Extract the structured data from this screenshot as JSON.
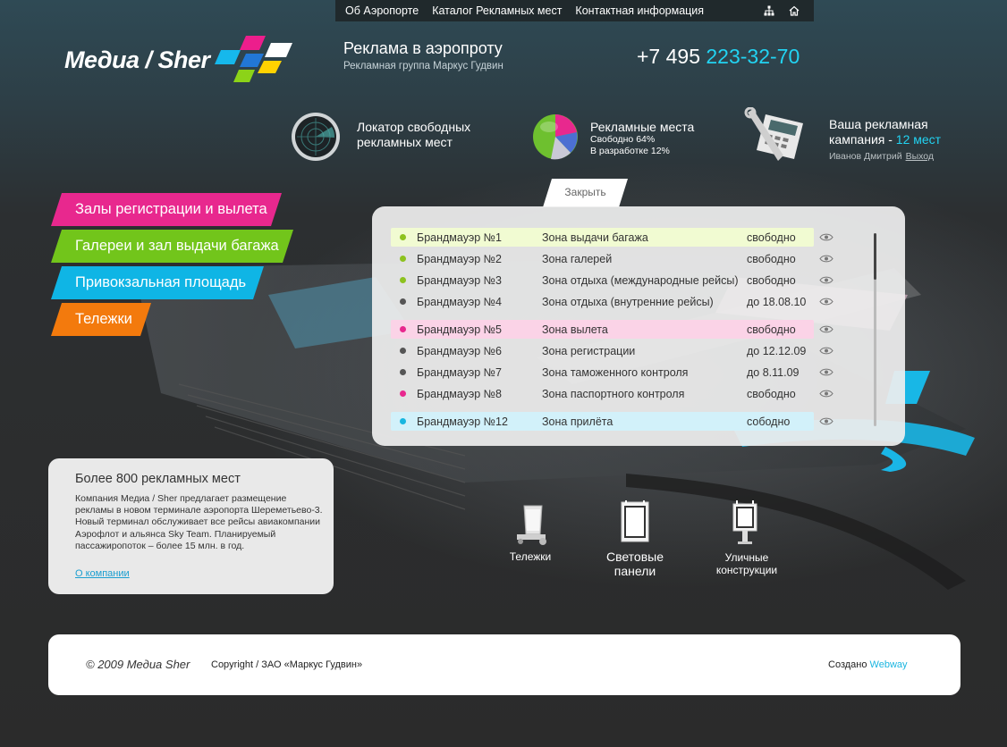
{
  "nav": {
    "links": [
      "Об Аэропорте",
      "Каталог Рекламных мест",
      "Контактная информация"
    ],
    "icons": [
      "sitemap-icon",
      "home-icon"
    ]
  },
  "logo": {
    "text": "Медиа / Sher"
  },
  "header": {
    "title": "Реклама в аэропроту",
    "subtitle": "Рекламная группа Маркус Гудвин",
    "phone_prefix": "+7 495 ",
    "phone_number": "223-32-70"
  },
  "info": {
    "locator": {
      "title_line1": "Локатор свободных",
      "title_line2": "рекламных мест",
      "icon": "radar-icon"
    },
    "places": {
      "title": "Рекламные места",
      "free": "Свободно 64%",
      "dev": "В разработке 12%",
      "icon": "pie-chart-icon"
    },
    "campaign": {
      "title_line1": "Ваша рекламная",
      "title_line2": "кампания - ",
      "count": "12 мест",
      "user": "Иванов Дмитрий",
      "logout": "Выход",
      "icon": "calculator-tools-icon"
    }
  },
  "categories": [
    {
      "label": "Залы регистрации и вылета",
      "color": "#e8288e"
    },
    {
      "label": "Галереи и зал выдачи багажа",
      "color": "#72c51b"
    },
    {
      "label": "Привокзальная площадь",
      "color": "#0fb5e5"
    },
    {
      "label": "Тележки",
      "color": "#f37a0d"
    }
  ],
  "close_label": "Закрыть",
  "list": [
    {
      "name": "Брандмауэр №1",
      "zone": "Зона выдачи багажа",
      "status": "свободно",
      "dot": "#8dc21f",
      "highlight": "#f1fbd2"
    },
    {
      "name": "Брандмауэр №2",
      "zone": "Зона галерей",
      "status": "свободно",
      "dot": "#8dc21f",
      "highlight": ""
    },
    {
      "name": "Брандмауэр №3",
      "zone": "Зона отдыха (международные рейсы)",
      "status": "свободно",
      "dot": "#8dc21f",
      "highlight": ""
    },
    {
      "name": "Брандмауэр №4",
      "zone": "Зона отдыха (внутренние рейсы)",
      "status": "до 18.08.10",
      "dot": "#555555",
      "highlight": ""
    },
    {
      "name": "Брандмауэр №5",
      "zone": "Зона вылета",
      "status": "свободно",
      "dot": "#e8288e",
      "highlight": "#fbd3e7"
    },
    {
      "name": "Брандмауэр №6",
      "zone": "Зона регистрации",
      "status": "до 12.12.09",
      "dot": "#555555",
      "highlight": ""
    },
    {
      "name": "Брандмауэр №7",
      "zone": "Зона таможенного контроля",
      "status": "до 8.11.09",
      "dot": "#555555",
      "highlight": ""
    },
    {
      "name": "Брандмауэр №8",
      "zone": "Зона паспортного контроля",
      "status": "свободно",
      "dot": "#e8288e",
      "highlight": ""
    },
    {
      "name": "Брандмауэр №12",
      "zone": "Зона прилёта",
      "status": "сободно",
      "dot": "#17b6e0",
      "highlight": "#d2f1fa"
    }
  ],
  "about": {
    "title": "Более 800 рекламных мест",
    "text": "Компания Медиа / Sher предлагает размещение рекламы в новом терминале аэропорта Шереметьево-3. Новый терминал обслуживает все рейсы авиакомпании Аэрофлот и альянса Sky Team. Планируемый пассажиропоток – более 15 млн. в год.",
    "link": "О компании"
  },
  "products": [
    {
      "label": "Тележки",
      "icon": "trolley-icon"
    },
    {
      "label": "Световые панели",
      "icon": "light-panel-icon"
    },
    {
      "label": "Уличные конструкции",
      "icon": "billboard-icon"
    }
  ],
  "footer": {
    "copy": "© 2009 Медиа Sher",
    "company": "Copyright / ЗАО «Маркус Гудвин»",
    "created_prefix": "Создано ",
    "created_by": "Webway"
  }
}
